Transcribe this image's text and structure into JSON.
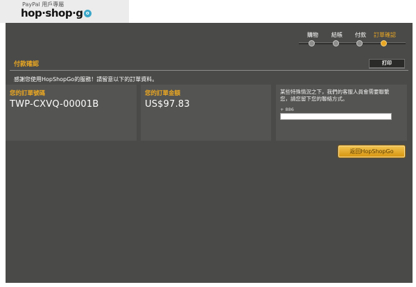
{
  "brand": {
    "subtitle": "PayPal 用戶專屬",
    "logo_text": "hop·shop·g",
    "logo_badge": "o"
  },
  "steps": [
    {
      "label": "購物",
      "active": false
    },
    {
      "label": "結帳",
      "active": false
    },
    {
      "label": "付款",
      "active": false
    },
    {
      "label": "訂單確認",
      "active": true
    }
  ],
  "section": {
    "title": "付款確認",
    "print_label": "打印"
  },
  "intro_text": "感謝您使用HopShopGo的服務！請留意以下的訂單資料。",
  "order_number": {
    "label": "您的訂單號碼",
    "value": "TWP-CXVQ-00001B"
  },
  "order_total": {
    "label": "您的訂單金額",
    "value": "US$97.83"
  },
  "contact": {
    "note": "某些特殊情況之下，我們的客服人員會需要聯繫您，請您留下您的聯絡方式。",
    "phone_prefix": "+ 886",
    "phone_value": ""
  },
  "return_button_label": "返回HopShopGo",
  "colors": {
    "accent": "#e8a623",
    "panel": "#4a4a48",
    "card": "#545452"
  }
}
